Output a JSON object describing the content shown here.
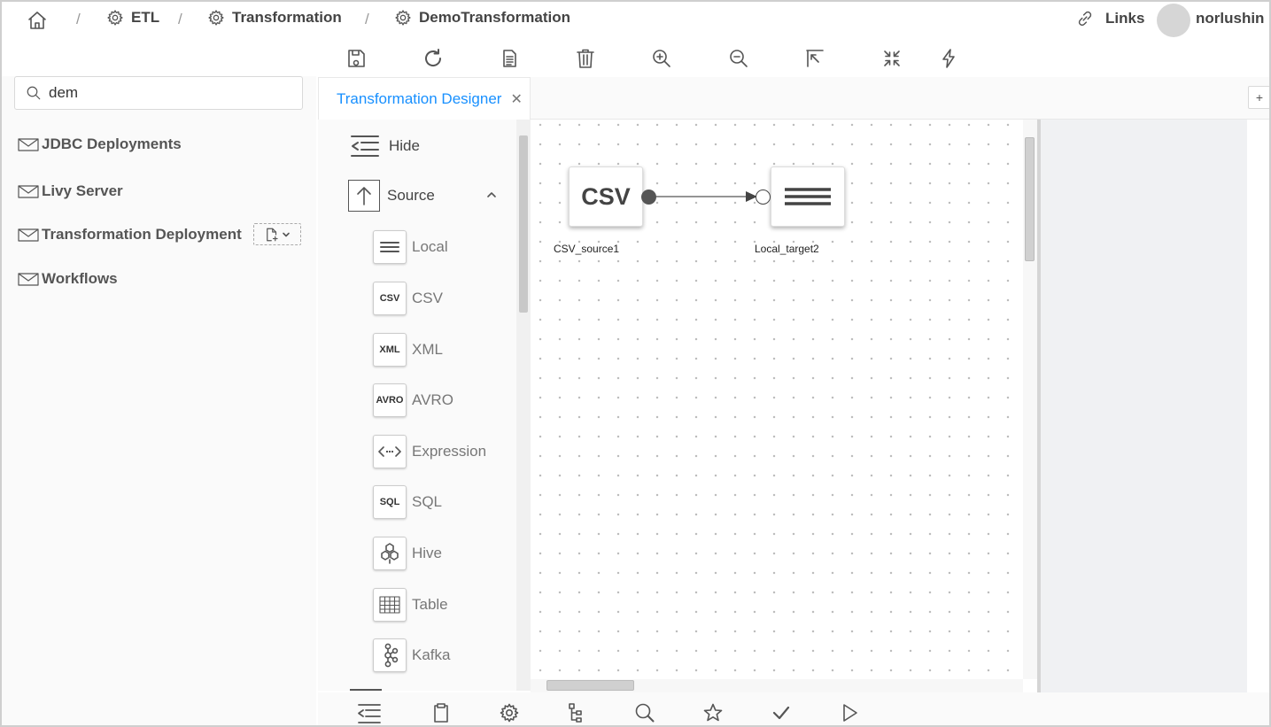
{
  "breadcrumb": {
    "items": [
      {
        "label": "ETL"
      },
      {
        "label": "Transformation"
      },
      {
        "label": "DemoTransformation"
      }
    ],
    "separator": "/"
  },
  "header": {
    "links_label": "Links",
    "username": "norlushin"
  },
  "toolbar": {
    "icons": [
      "save-icon",
      "refresh-icon",
      "document-icon",
      "delete-icon",
      "zoom-in-icon",
      "zoom-out-icon",
      "fit-to-page-icon",
      "collapse-icon",
      "run-icon"
    ]
  },
  "search": {
    "value": "dem"
  },
  "sidebar": {
    "items": [
      {
        "label": "JDBC Deployments"
      },
      {
        "label": "Livy Server"
      },
      {
        "label": "Transformation Deployment"
      },
      {
        "label": "Workflows"
      }
    ]
  },
  "tabs": [
    {
      "label": "Transformation Designer",
      "active": true
    }
  ],
  "addtab_label": "+",
  "palette": {
    "hide_label": "Hide",
    "section_label": "Source",
    "items": [
      {
        "label": "Local",
        "icon": "lines-icon"
      },
      {
        "label": "CSV",
        "icon_text": "CSV"
      },
      {
        "label": "XML",
        "icon_text": "XML"
      },
      {
        "label": "AVRO",
        "icon_text": "AVRO"
      },
      {
        "label": "Expression",
        "icon": "expression-icon"
      },
      {
        "label": "SQL",
        "icon_text": "SQL"
      },
      {
        "label": "Hive",
        "icon": "hive-icon"
      },
      {
        "label": "Table",
        "icon": "table-icon"
      },
      {
        "label": "Kafka",
        "icon": "kafka-icon"
      }
    ]
  },
  "diagram": {
    "nodes": [
      {
        "id": "csv",
        "text": "CSV",
        "label": "CSV_source1"
      },
      {
        "id": "local",
        "label": "Local_target2"
      }
    ]
  },
  "bottom_toolbar": {
    "icons": [
      "outline-icon",
      "clipboard-icon",
      "settings-icon",
      "tree-icon",
      "search-icon",
      "star-icon",
      "check-icon",
      "play-icon"
    ]
  },
  "colors": {
    "accent": "#1890ff",
    "text": "#444444",
    "panel": "#fafafa"
  }
}
